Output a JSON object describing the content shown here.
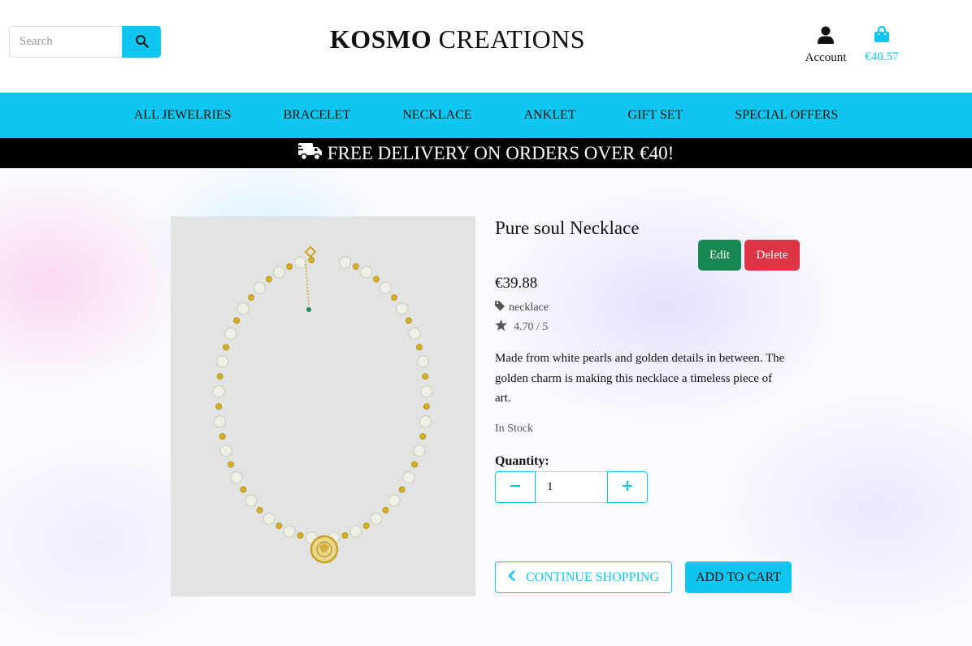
{
  "search": {
    "placeholder": "Search"
  },
  "brand": {
    "bold": "KOSMO",
    "rest": " CREATIONS"
  },
  "account": {
    "label": "Account"
  },
  "cart": {
    "total": "€40.57"
  },
  "nav": {
    "items": [
      "ALL JEWELRIES",
      "BRACELET",
      "NECKLACE",
      "ANKLET",
      "GIFT SET",
      "SPECIAL OFFERS"
    ]
  },
  "banner": {
    "text": "FREE DELIVERY ON ORDERS OVER €40!"
  },
  "product": {
    "name": "Pure soul Necklace",
    "price": "€39.88",
    "category": "necklace",
    "rating": "4.70 / 5",
    "description": "Made from white pearls and golden details in between. The golden charm is making this necklace a timeless piece of art.",
    "stock": "In Stock"
  },
  "admin": {
    "edit_label": "Edit",
    "delete_label": "Delete"
  },
  "quantity": {
    "label": "Quantity:",
    "value": "1"
  },
  "actions": {
    "continue_label": "CONTINUE SHOPPING",
    "add_to_cart_label": "ADD TO CART"
  },
  "colors": {
    "accent": "#0ec6ef",
    "edit": "#198754",
    "delete": "#dc3545",
    "banner": "#000000"
  },
  "icons": {
    "search": "search-icon",
    "account": "user-icon",
    "cart": "shopping-bag-icon",
    "truck": "truck-icon",
    "tag": "tag-icon",
    "star": "star-icon",
    "minus": "minus-icon",
    "plus": "plus-icon",
    "chevron": "chevron-left-icon"
  }
}
